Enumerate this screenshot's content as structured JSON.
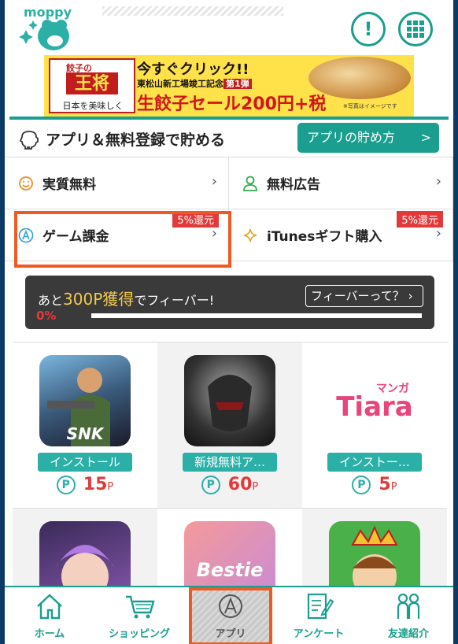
{
  "header": {
    "logo_text": "moppy",
    "info_icon": "exclamation-circle-icon",
    "menu_icon": "grid-menu-icon"
  },
  "banner": {
    "brand_top": "餃子の",
    "brand_main": "王将",
    "brand_sub": "日本を美味しく",
    "headline": "今すぐクリック!!",
    "sub1": "東松山新工場竣工記念",
    "sub1_badge": "第1弾",
    "sale": "生餃子セール200円+税",
    "note": "※写真はイメージです"
  },
  "section": {
    "title": "アプリ＆無料登録で貯める",
    "howto_label": "アプリの貯め方",
    "howto_chevron": ">"
  },
  "categories": [
    {
      "label": "実質無料",
      "icon": "smile-icon",
      "badge": ""
    },
    {
      "label": "無料広告",
      "icon": "person-icon",
      "badge": ""
    },
    {
      "label": "ゲーム課金",
      "icon": "circled-a-icon",
      "badge": "5%還元"
    },
    {
      "label": "iTunesギフト購入",
      "icon": "sparkle-icon",
      "badge": "5%還元"
    }
  ],
  "fever": {
    "prefix": "あと",
    "highlight": "300P獲得",
    "suffix": "でフィーバー!",
    "link": "フィーバーって？",
    "percent": "0%",
    "progress": 0
  },
  "apps": [
    {
      "tag": "インストール",
      "points": "15",
      "unit": "P",
      "thumb_text": "SNK"
    },
    {
      "tag": "新規無料ア…",
      "points": "60",
      "unit": "P",
      "thumb_text": ""
    },
    {
      "tag": "インストー…",
      "points": "5",
      "unit": "P",
      "thumb_text": "Tiara",
      "thumb_sub": "マンガ"
    },
    {
      "tag": "",
      "points": "",
      "unit": "",
      "thumb_text": ""
    },
    {
      "tag": "",
      "points": "",
      "unit": "",
      "thumb_text": "Bestie"
    },
    {
      "tag": "",
      "points": "",
      "unit": "",
      "thumb_text": ""
    }
  ],
  "point_symbol": "P",
  "nav": {
    "home": "ホーム",
    "shopping": "ショッピング",
    "app": "アプリ",
    "survey": "アンケート",
    "invite": "友達紹介"
  },
  "colors": {
    "brand": "#1a9e8f",
    "accent": "#e23a3a",
    "highlight": "#f05a22"
  }
}
